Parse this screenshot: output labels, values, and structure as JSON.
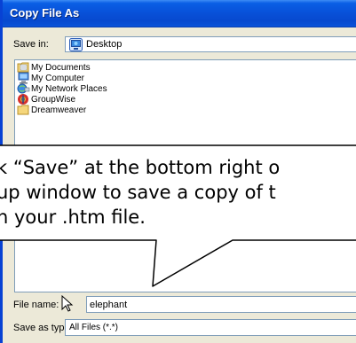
{
  "window": {
    "title": "Copy File As"
  },
  "save_in": {
    "label": "Save in:",
    "value": "Desktop",
    "icon": "desktop-icon"
  },
  "file_list": {
    "items": [
      {
        "label": "My Documents",
        "icon": "folder-documents-icon"
      },
      {
        "label": "My Computer",
        "icon": "computer-icon"
      },
      {
        "label": "My Network Places",
        "icon": "network-places-icon"
      },
      {
        "label": "GroupWise",
        "icon": "groupwise-icon"
      },
      {
        "label": "Dreamweaver",
        "icon": "folder-icon"
      }
    ]
  },
  "file_name": {
    "label": "File name:",
    "value": "elephant"
  },
  "save_as_type": {
    "label": "Save as type:",
    "value": "All Files (*.*)"
  },
  "callout": {
    "lines": [
      "k “Save” at the bottom right o",
      "up window to save a copy of t",
      "n your .htm file."
    ]
  },
  "colors": {
    "titlebar": "#0850d8",
    "window_bg": "#ece9d8",
    "field_border": "#7f9db9"
  }
}
